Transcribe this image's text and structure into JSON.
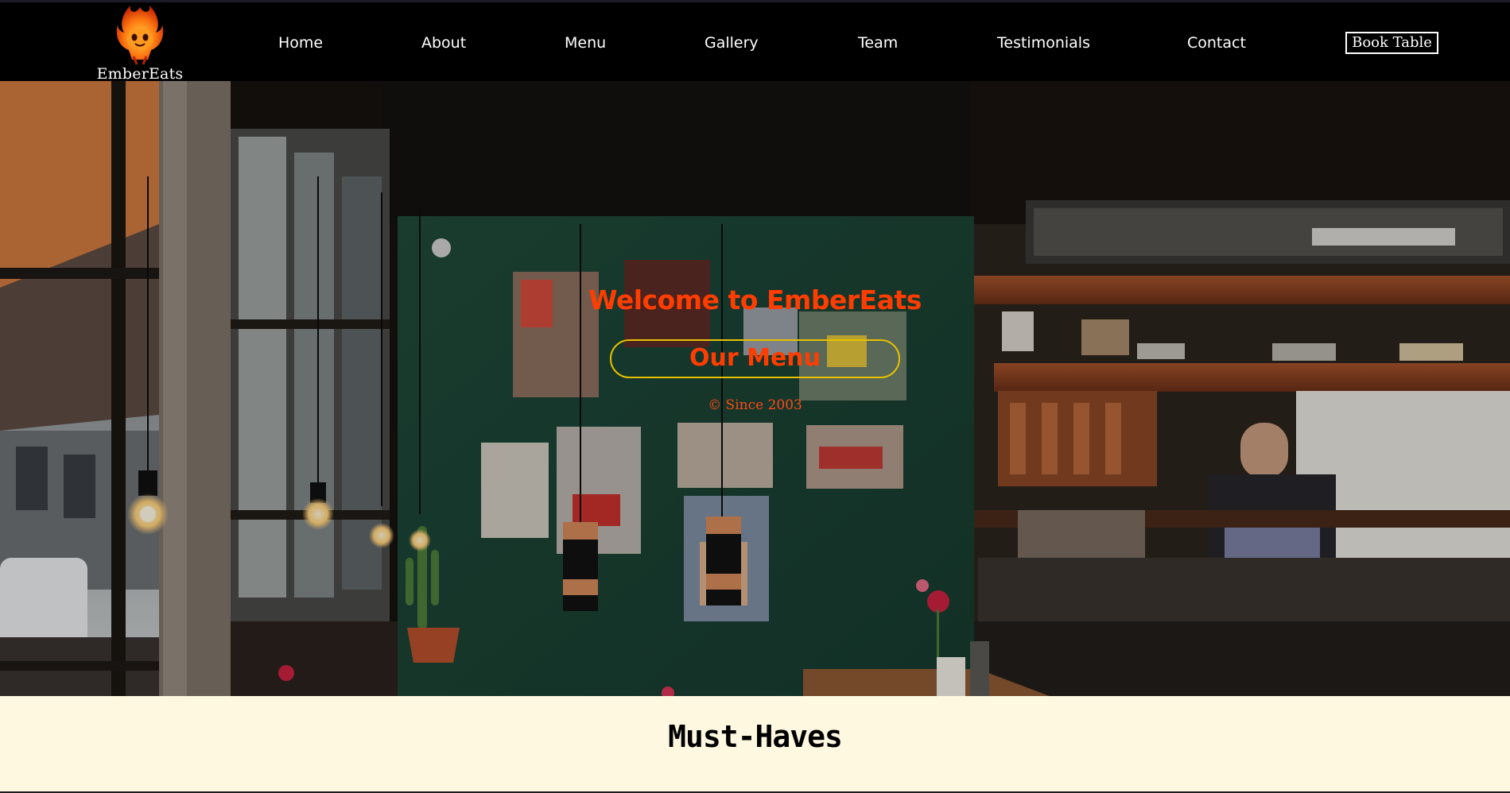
{
  "brand": {
    "name": "EmberEats",
    "logo_icon": "flame-mascot-icon"
  },
  "nav": {
    "items": [
      {
        "label": "Home"
      },
      {
        "label": "About"
      },
      {
        "label": "Menu"
      },
      {
        "label": "Gallery"
      },
      {
        "label": "Team"
      },
      {
        "label": "Testimonials"
      },
      {
        "label": "Contact"
      }
    ],
    "book_label": "Book Table"
  },
  "hero": {
    "title": "Welcome to EmberEats",
    "cta_label": "Our Menu",
    "since": "© Since 2003",
    "background": "restaurant-interior-photo"
  },
  "section": {
    "title": "Must-Haves"
  },
  "colors": {
    "accent": "#ff3d00",
    "button_border": "#e8c100",
    "nav_bg": "#000000",
    "section_bg": "#fff8e1"
  }
}
